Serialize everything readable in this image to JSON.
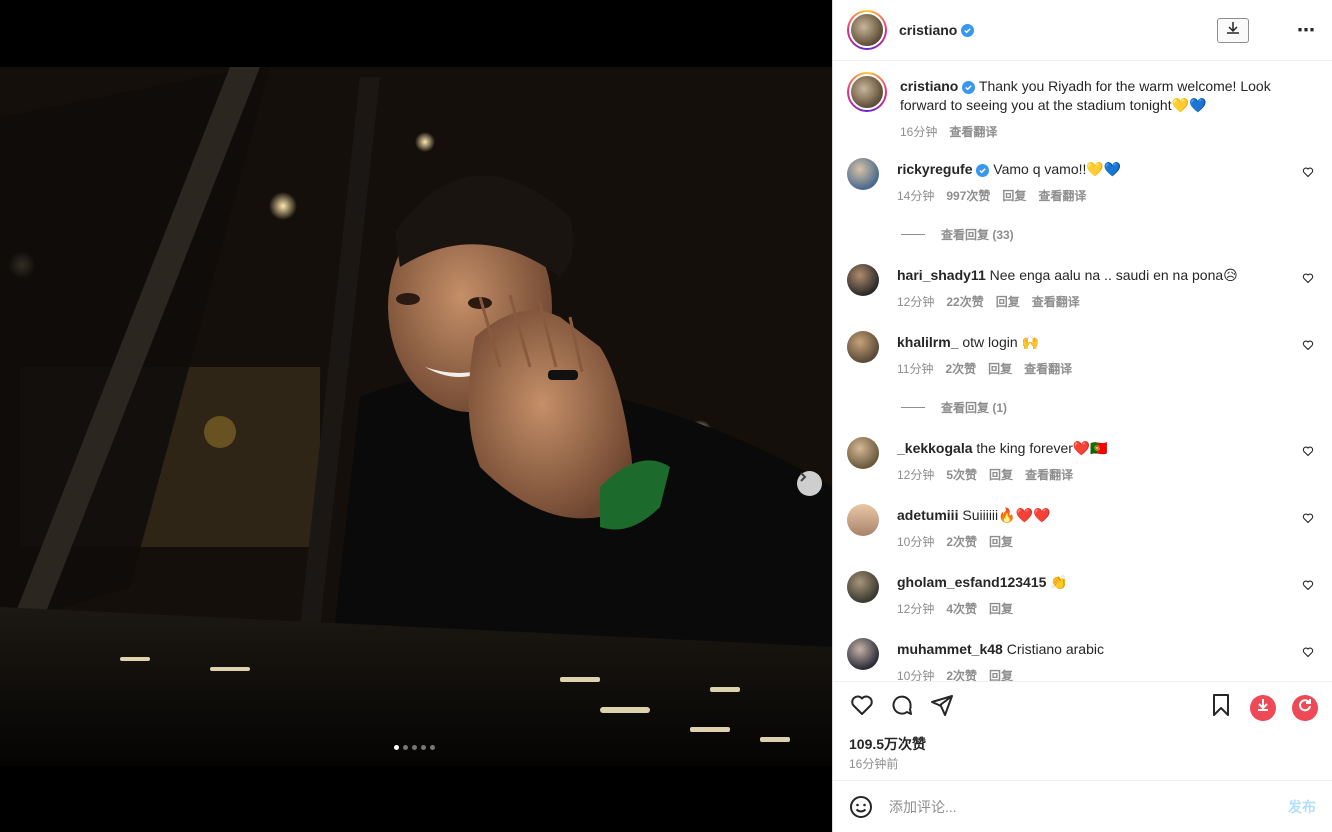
{
  "post": {
    "username": "cristiano",
    "carousel_dots": 5,
    "carousel_active": 0
  },
  "caption": {
    "username": "cristiano",
    "text": "Thank you Riyadh for the warm welcome! Look forward to seeing you at the stadium tonight💛💙",
    "time": "16分钟",
    "translate": "查看翻译"
  },
  "comments": [
    {
      "username": "ricky regufe",
      "user_display": "rickyregufe",
      "verified": true,
      "text": "Vamo q vamo!!💛💙",
      "time": "14分钟",
      "likes": "997次赞",
      "reply": "回复",
      "translate": "查看翻译",
      "replies": "查看回复 (33)",
      "avatar_color": "#4a6a8c"
    },
    {
      "user_display": "hari_shady11",
      "text": "Nee enga aalu na .. saudi en na pona😥",
      "time": "12分钟",
      "likes": "22次赞",
      "reply": "回复",
      "translate": "查看翻译",
      "avatar_color": "#3b3b3b"
    },
    {
      "user_display": "khalilrm_",
      "text": "otw login 🙌",
      "time": "11分钟",
      "likes": "2次赞",
      "reply": "回复",
      "translate": "查看翻译",
      "replies": "查看回复 (1)",
      "avatar_color": "#5a4a3a"
    },
    {
      "user_display": "_kekkogala",
      "text": "the king forever❤️🇵🇹",
      "time": "12分钟",
      "likes": "5次赞",
      "reply": "回复",
      "translate": "查看翻译",
      "avatar_color": "#6b5a3e"
    },
    {
      "user_display": "adetumiii",
      "text": "Suiiiiii🔥❤️❤️",
      "time": "10分钟",
      "likes": "2次赞",
      "reply": "回复",
      "avatar_color": "#d4a88a"
    },
    {
      "user_display": "gholam_esfand123415",
      "text": "👏",
      "time": "12分钟",
      "likes": "4次赞",
      "reply": "回复",
      "avatar_color": "#4a4a40"
    },
    {
      "user_display": "muhammet_k48",
      "text": "Cristiano arabic",
      "time": "10分钟",
      "likes": "2次赞",
      "reply": "回复",
      "avatar_color": "#2d2d3a"
    }
  ],
  "stats": {
    "likes": "109.5万次赞",
    "posted": "16分钟前"
  },
  "add_comment": {
    "placeholder": "添加评论...",
    "post_label": "发布"
  },
  "icons": {
    "heart": "heart-icon",
    "comment": "comment-icon",
    "share": "share-icon",
    "save": "bookmark-icon",
    "download_red": "download-icon",
    "refresh_red": "refresh-icon"
  },
  "colors": {
    "accent_red": "#ed4956",
    "verified_blue": "#3897f0"
  }
}
